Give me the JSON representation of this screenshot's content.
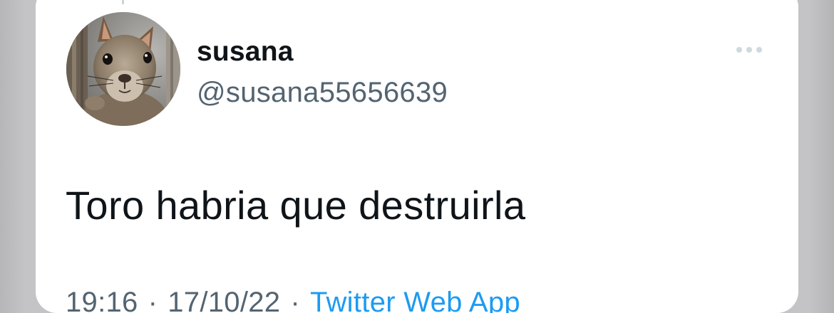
{
  "tweet": {
    "display_name": "susana",
    "handle": "@susana55656639",
    "text": "Toro habria que destruirla",
    "time": "19:16",
    "date": "17/10/22",
    "separator": "·",
    "source": "Twitter Web App"
  },
  "icons": {
    "more": "more-horizontal-icon",
    "avatar": "squirrel-photo"
  },
  "colors": {
    "text_primary": "#0f1419",
    "text_secondary": "#536471",
    "link": "#1d9bf0",
    "card": "#ffffff",
    "background": "#c6c6c8"
  }
}
